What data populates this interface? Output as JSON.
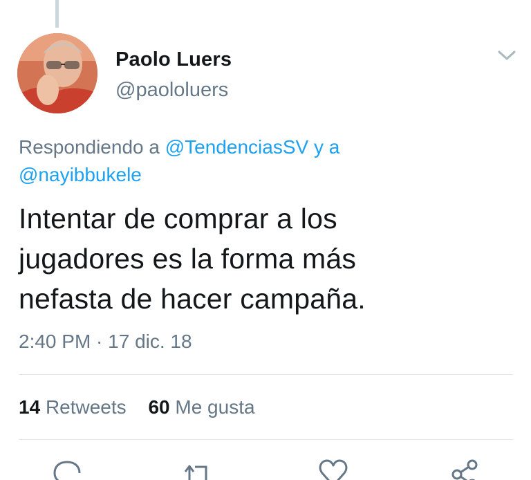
{
  "author": {
    "name": "Paolo Luers",
    "handle": "@paololuers",
    "avatar_icon": "person-photo-avatar"
  },
  "reply": {
    "prefix": "Respondiendo a",
    "mention_1": "@TendenciasSV",
    "connector": "y a",
    "mention_2": "@nayibbukele"
  },
  "tweet": {
    "lines": [
      "Intentar de comprar a los",
      "jugadores es la forma más",
      "nefasta de hacer campaña."
    ]
  },
  "meta": {
    "timestamp": "2:40 PM · 17 dic. 18"
  },
  "stats": {
    "retweets_count": "14",
    "retweets_label": "Retweets",
    "likes_count": "60",
    "likes_label": "Me gusta"
  },
  "actions": {
    "reply_icon": "reply-icon",
    "retweet_icon": "retweet-icon",
    "like_icon": "heart-icon",
    "share_icon": "share-icon"
  },
  "colors": {
    "link": "#1da1f2",
    "secondary_text": "#657786",
    "primary_text": "#14171a",
    "divider": "#e1e8ed"
  }
}
